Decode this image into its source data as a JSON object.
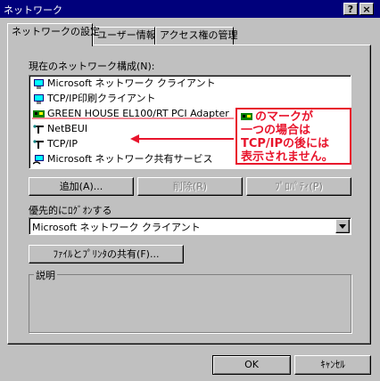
{
  "window": {
    "title": "ネットワーク",
    "help_btn": "?",
    "close_btn": "×"
  },
  "tabs": [
    {
      "label": "ネットワークの設定"
    },
    {
      "label": "ユーザー情報"
    },
    {
      "label": "アクセス権の管理"
    }
  ],
  "components": {
    "label": "現在のネットワーク構成(N):",
    "items": [
      {
        "label": "Microsoft ネットワーク クライアント",
        "icon": "client-icon"
      },
      {
        "label": "TCP/IP印刷クライアント",
        "icon": "client-icon"
      },
      {
        "label": "GREEN HOUSE EL100/RT PCI Adapter",
        "icon": "adapter-icon"
      },
      {
        "label": "NetBEUI",
        "icon": "protocol-icon"
      },
      {
        "label": "TCP/IP",
        "icon": "protocol-icon"
      },
      {
        "label": "Microsoft ネットワーク共有サービス",
        "icon": "service-icon"
      }
    ]
  },
  "buttons": {
    "add": "追加(A)...",
    "remove": "削除(R)",
    "properties": "ﾌﾟﾛﾊﾟﾃｨ(P)"
  },
  "primary_logon": {
    "label": "優先的にﾛｸﾞｵﾝする",
    "value": "Microsoft ネットワーク クライアント"
  },
  "file_print_sharing": "ﾌｧｲﾙとﾌﾟﾘﾝﾀの共有(F)...",
  "description": {
    "label": "説明"
  },
  "dialog": {
    "ok": "OK",
    "cancel": "ｷｬﾝｾﾙ"
  },
  "annotation": {
    "line1": "のマークが",
    "line2": "一つの場合は",
    "line3": "TCP/IPの後には",
    "line4": "表示されません。",
    "color": "#e8142c"
  }
}
